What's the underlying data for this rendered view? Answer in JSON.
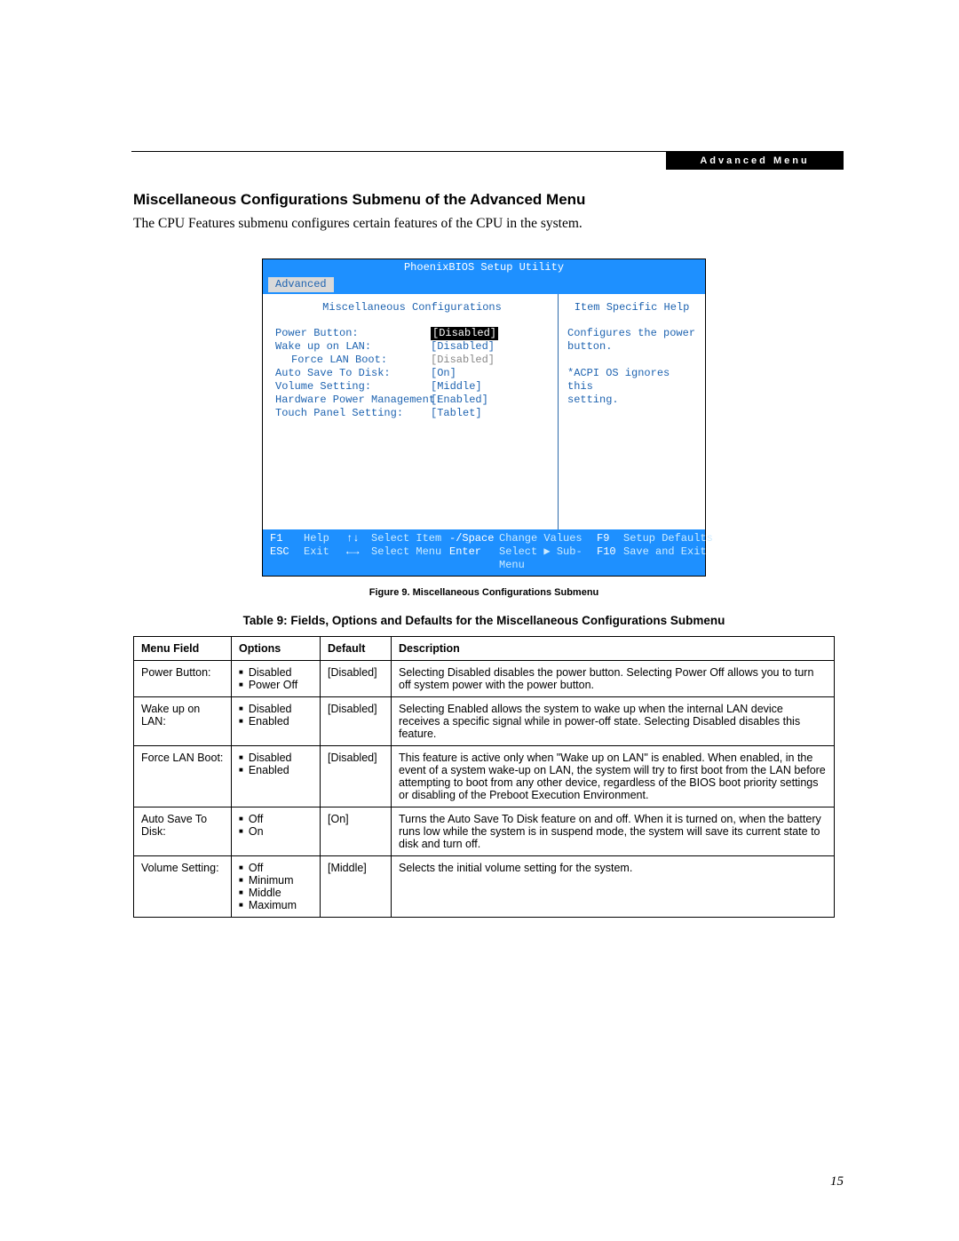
{
  "header": {
    "tag": "Advanced Menu"
  },
  "section": {
    "heading": "Miscellaneous Configurations Submenu of the Advanced Menu",
    "intro": "The CPU Features submenu configures certain features of the CPU in the system."
  },
  "bios": {
    "title": "PhoenixBIOS Setup Utility",
    "menubar_selected": "Advanced",
    "left_title": "Miscellaneous Configurations",
    "right_title": "Item Specific Help",
    "items": [
      {
        "label": "Power Button:",
        "value": "[Disabled]",
        "selected": true,
        "dim": false,
        "indent": false
      },
      {
        "label": "Wake up on LAN:",
        "value": "[Disabled]",
        "selected": false,
        "dim": false,
        "indent": false
      },
      {
        "label": "Force LAN Boot:",
        "value": "[Disabled]",
        "selected": false,
        "dim": true,
        "indent": true
      },
      {
        "label": "Auto Save To Disk:",
        "value": "[On]",
        "selected": false,
        "dim": false,
        "indent": false
      },
      {
        "label": "Volume Setting:",
        "value": "[Middle]",
        "selected": false,
        "dim": false,
        "indent": false
      },
      {
        "label": "Hardware Power Management:",
        "value": "[Enabled]",
        "selected": false,
        "dim": false,
        "indent": false
      },
      {
        "label": "Touch Panel Setting:",
        "value": "[Tablet]",
        "selected": false,
        "dim": false,
        "indent": false
      }
    ],
    "help_lines": [
      "Configures the power",
      "button.",
      "",
      "*ACPI OS ignores this",
      "setting."
    ],
    "footer": {
      "row1": {
        "k1": "F1",
        "a1": "Help",
        "k2": "↑↓",
        "a2": "Select Item",
        "k3": "-/Space",
        "a3": "Change Values",
        "k4": "F9",
        "a4": "Setup Defaults"
      },
      "row2": {
        "k1": "ESC",
        "a1": "Exit",
        "k2": "←→",
        "a2": "Select Menu",
        "k3": "Enter",
        "a3": "Select ▶ Sub-Menu",
        "k4": "F10",
        "a4": "Save and Exit"
      }
    }
  },
  "figure_caption": "Figure 9.   Miscellaneous Configurations Submenu",
  "table_caption": "Table 9: Fields, Options and Defaults for the Miscellaneous Configurations Submenu",
  "table": {
    "headers": [
      "Menu Field",
      "Options",
      "Default",
      "Description"
    ],
    "rows": [
      {
        "field": "Power Button:",
        "options": [
          "Disabled",
          "Power Off"
        ],
        "default": "[Disabled]",
        "desc": "Selecting Disabled disables the power button. Selecting Power Off allows you to turn off system power with the power button."
      },
      {
        "field": "Wake up on LAN:",
        "options": [
          "Disabled",
          "Enabled"
        ],
        "default": "[Disabled]",
        "desc": "Selecting Enabled allows the system to wake up when the internal LAN device receives a specific signal while in power-off state. Selecting Disabled disables this feature."
      },
      {
        "field": "Force LAN Boot:",
        "options": [
          "Disabled",
          "Enabled"
        ],
        "default": "[Disabled]",
        "desc": "This feature is active only when \"Wake up on LAN\" is enabled. When enabled, in the event of a system wake-up on LAN, the system will try to first boot from the LAN before attempting to boot from any other device, regardless of the BIOS boot priority settings or disabling of the Preboot Execution Environment."
      },
      {
        "field": "Auto Save To Disk:",
        "options": [
          "Off",
          "On"
        ],
        "default": "[On]",
        "desc": "Turns the Auto Save To Disk feature on and off. When it is turned on, when the battery runs low while the system is in suspend mode, the system will save its current state to disk and turn off."
      },
      {
        "field": "Volume Setting:",
        "options": [
          "Off",
          "Minimum",
          "Middle",
          "Maximum"
        ],
        "default": "[Middle]",
        "desc": "Selects the initial volume setting for the system."
      }
    ]
  },
  "page_number": "15"
}
